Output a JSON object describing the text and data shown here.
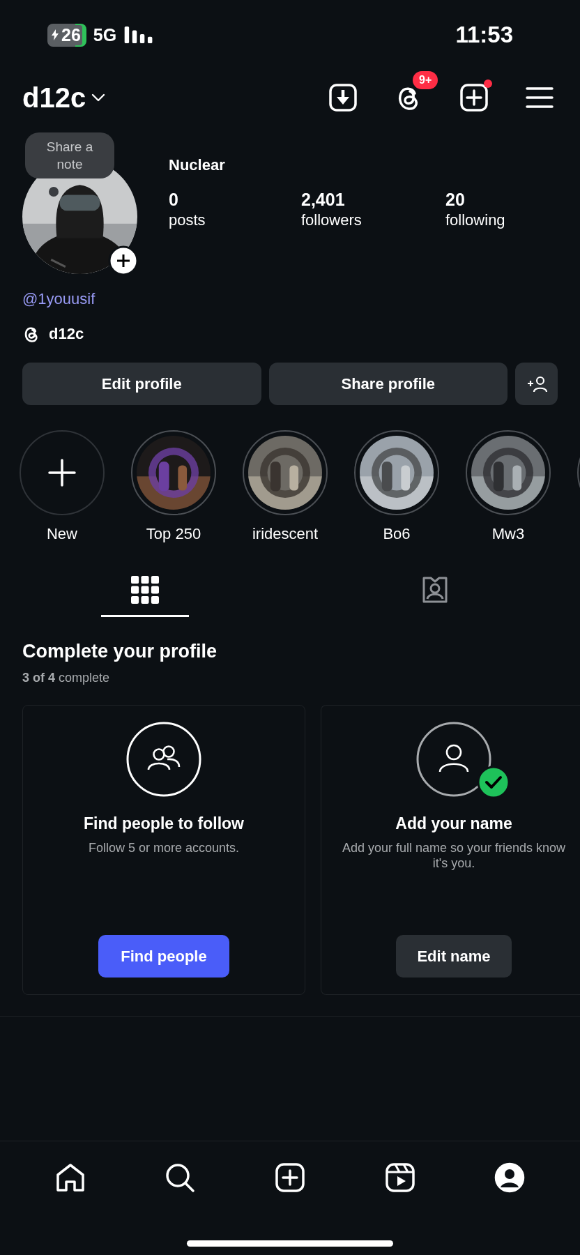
{
  "status_bar": {
    "battery": "26",
    "network": "5G",
    "time": "11:53"
  },
  "header": {
    "username": "d12c",
    "activity_badge": "9+",
    "create_dot": true
  },
  "profile": {
    "note": "Share a note",
    "display_name": "Nuclear",
    "stats": [
      {
        "value": "0",
        "label": "posts"
      },
      {
        "value": "2,401",
        "label": "followers"
      },
      {
        "value": "20",
        "label": "following"
      }
    ],
    "handle": "@1youusif",
    "threads_name": "d12c"
  },
  "actions": [
    "Edit profile",
    "Share profile"
  ],
  "highlights": [
    {
      "kind": "new",
      "label": "New"
    },
    {
      "kind": "picture",
      "label": "Top 250"
    },
    {
      "kind": "picture",
      "label": "iridescent"
    },
    {
      "kind": "picture",
      "label": "Bo6"
    },
    {
      "kind": "picture",
      "label": "Mw3"
    },
    {
      "kind": "ring"
    }
  ],
  "tabs": [
    {
      "kind": "grid",
      "selected": true
    },
    {
      "kind": "tagged",
      "selected": false
    }
  ],
  "complete": {
    "title": "Complete your profile",
    "progress": "**3 of 4** complete"
  },
  "cards": [
    {
      "kind": "people",
      "title": "Find people to follow",
      "description": "Follow 5 or more accounts.",
      "button": "Find people",
      "done": false
    },
    {
      "kind": "person",
      "title": "Add your name",
      "description": "Add your full name so your friends know it's you.",
      "button": "Edit name",
      "done": true
    }
  ],
  "nav": [
    {
      "kind": "home",
      "selected": false
    },
    {
      "kind": "search",
      "selected": false
    },
    {
      "kind": "create",
      "selected": false
    },
    {
      "kind": "reels",
      "selected": false
    },
    {
      "kind": "profile",
      "selected": true
    }
  ]
}
